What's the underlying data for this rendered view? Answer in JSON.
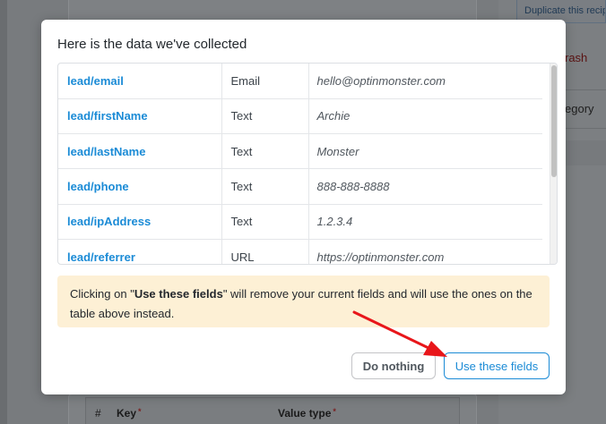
{
  "background": {
    "duplicate_label": "Duplicate this recipe",
    "trash_label": "rash",
    "category_label": "egory",
    "kv_table": {
      "hash": "#",
      "key": "Key",
      "value_type": "Value type",
      "required_mark": "*"
    }
  },
  "modal": {
    "title": "Here is the data we've collected",
    "rows": [
      {
        "key": "lead/email",
        "type": "Email",
        "value": "hello@optinmonster.com"
      },
      {
        "key": "lead/firstName",
        "type": "Text",
        "value": "Archie"
      },
      {
        "key": "lead/lastName",
        "type": "Text",
        "value": "Monster"
      },
      {
        "key": "lead/phone",
        "type": "Text",
        "value": "888-888-8888"
      },
      {
        "key": "lead/ipAddress",
        "type": "Text",
        "value": "1.2.3.4"
      },
      {
        "key": "lead/referrer",
        "type": "URL",
        "value": "https://optinmonster.com"
      }
    ],
    "notice": {
      "prefix": "Clicking on \"",
      "bold": "Use these fields",
      "suffix": "\" will remove your current fields and will use the ones on the table above instead."
    },
    "buttons": {
      "do_nothing": "Do nothing",
      "use_fields": "Use these fields"
    }
  },
  "colors": {
    "accent": "#1b8bd6",
    "notice_bg": "#fdf0d5",
    "arrow": "#e8161a"
  }
}
